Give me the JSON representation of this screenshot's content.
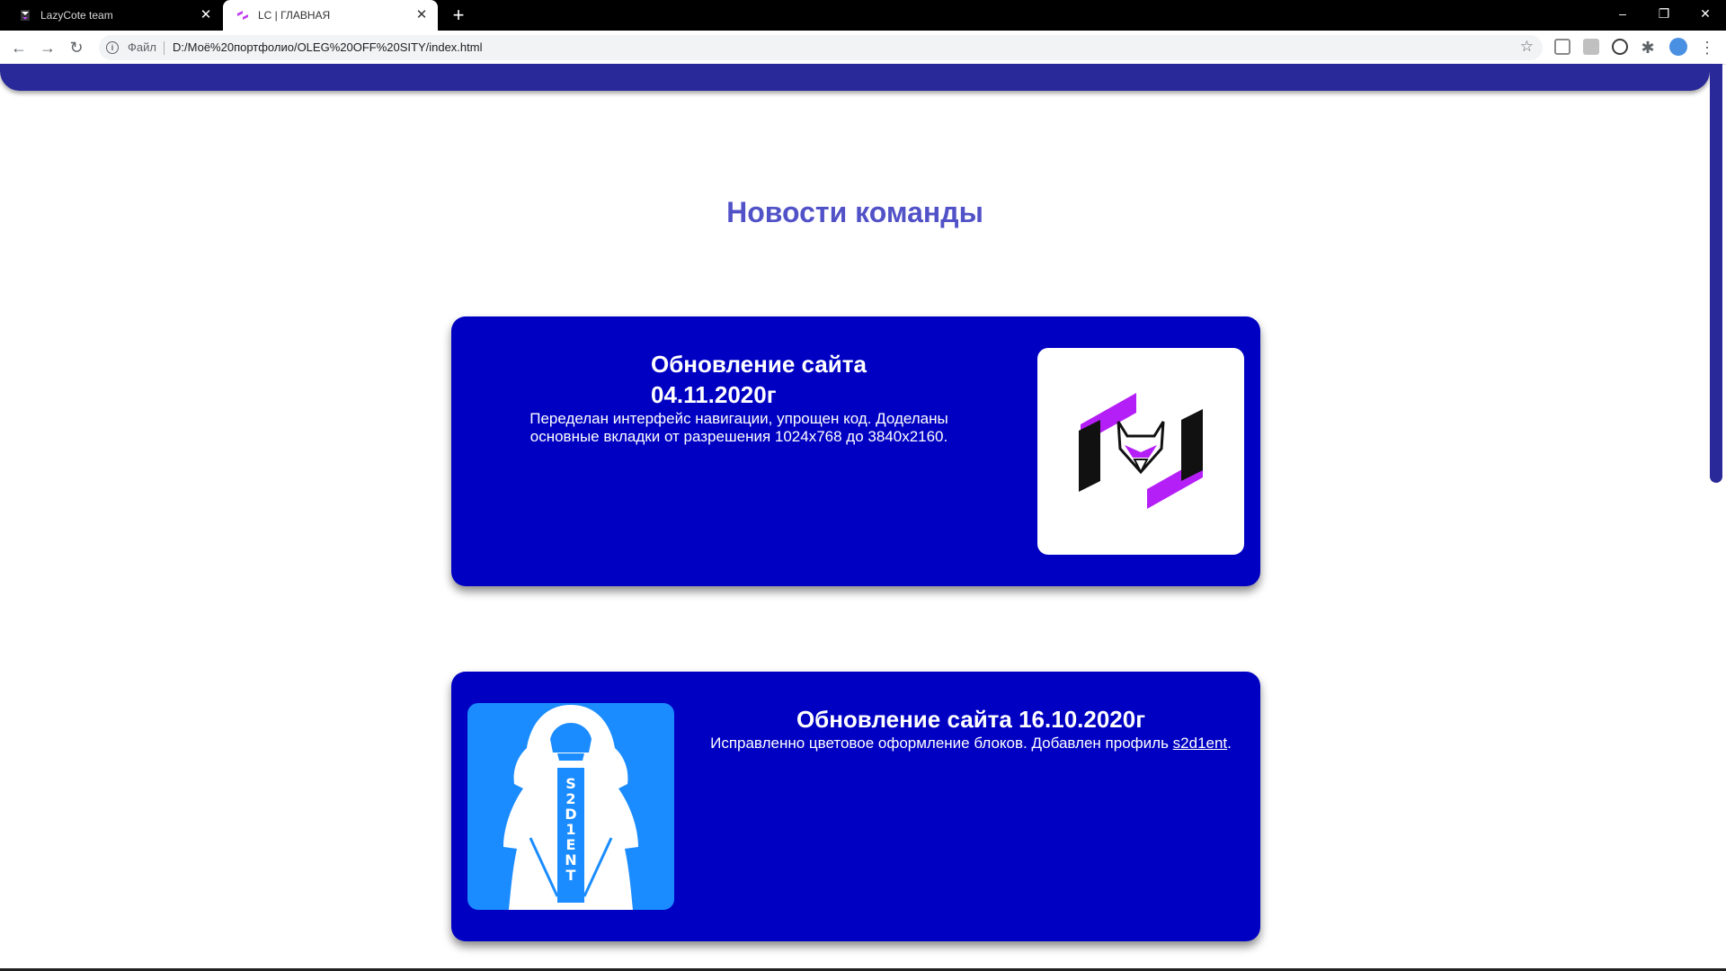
{
  "browser": {
    "tabs": [
      {
        "title": "LazyCote team",
        "active": false
      },
      {
        "title": "LC | ГЛАВНАЯ",
        "active": true
      }
    ],
    "address": {
      "scheme_label": "Файл",
      "url": "D:/Моё%20портфолио/OLEG%20OFF%20SITY/index.html"
    },
    "icons": {
      "back": "back-arrow-icon",
      "forward": "forward-arrow-icon",
      "reload": "reload-icon",
      "info": "info-icon",
      "bookmark": "star-icon",
      "extensions": "puzzle-icon",
      "menu": "kebab-menu-icon"
    }
  },
  "page": {
    "accent_color": "#29299a",
    "card_color": "#0000c3",
    "heading_color": "#5252c8",
    "heading": "Новости команды",
    "news": [
      {
        "title": "Обновление сайта 04.11.2020г",
        "body": "Переделан интерфейс навигации, упрощен код. Доделаны основные вкладки от разрешения 1024x768 до 3840x2160.",
        "image": "lazycote-logo"
      },
      {
        "title": "Обновление сайта 16.10.2020г",
        "body_before": "Исправленно цветовое оформление блоков. Добавлен профиль ",
        "link": "s2d1ent",
        "body_after": ".",
        "image": "s2d1ent-avatar"
      }
    ]
  }
}
